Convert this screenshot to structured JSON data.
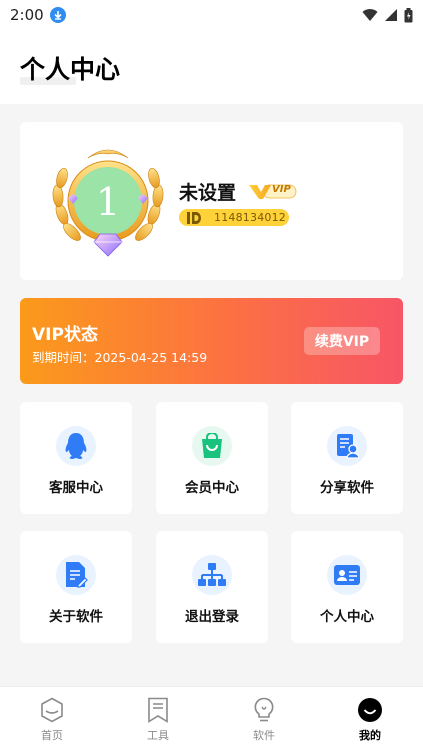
{
  "status": {
    "time": "2:00"
  },
  "header": {
    "title": "个人中心"
  },
  "profile": {
    "level_number": "1",
    "username": "未设置",
    "vip_badge": "VIP",
    "id_value": "1148134012"
  },
  "vip": {
    "title": "VIP状态",
    "expiry": "到期时间：2025-04-25 14:59",
    "renew_label": "续费VIP"
  },
  "tiles": [
    {
      "label": "客服中心",
      "icon": "penguin-icon"
    },
    {
      "label": "会员中心",
      "icon": "shopping-bag-icon"
    },
    {
      "label": "分享软件",
      "icon": "share-document-icon"
    },
    {
      "label": "关于软件",
      "icon": "edit-document-icon"
    },
    {
      "label": "退出登录",
      "icon": "org-chart-icon"
    },
    {
      "label": "个人中心",
      "icon": "id-card-icon"
    }
  ],
  "nav": [
    {
      "label": "首页",
      "icon": "hexagon-icon"
    },
    {
      "label": "工具",
      "icon": "bookmark-list-icon"
    },
    {
      "label": "软件",
      "icon": "lightbulb-icon"
    },
    {
      "label": "我的",
      "icon": "profile-smile-icon"
    }
  ],
  "colors": {
    "vip_gradient_start": "#fb9a1a",
    "vip_gradient_end": "#f75666",
    "id_pill": "#ffd23a",
    "tile_icon_blue": "#2f7cf6",
    "tile_icon_green": "#19c37d"
  }
}
